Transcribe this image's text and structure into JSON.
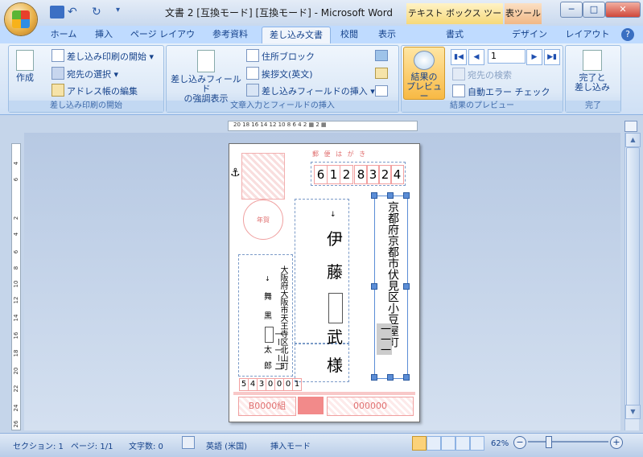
{
  "window": {
    "title": "文書 2 [互換モード] [互換モード] - Microsoft Word",
    "context_tab_textbox": "テキスト ボックス ツール",
    "context_tab_table": "表ツール",
    "min": "─",
    "max": "□",
    "close": "✕"
  },
  "tabs": [
    "ホーム",
    "挿入",
    "ページ レイアウト",
    "参考資料",
    "差し込み文書",
    "校閲",
    "表示",
    "書式",
    "デザイン",
    "レイアウト"
  ],
  "help": "?",
  "ribbon": {
    "create": "作成",
    "start_merge": "差し込み印刷の開始",
    "select_recipients": "宛先の選択",
    "edit_list": "アドレス帳の編集",
    "group1": "差し込み印刷の開始",
    "highlight_line1": "差し込みフィールド",
    "highlight_line2": "の強調表示",
    "address_block": "住所ブロック",
    "greeting": "挨拶文(英文)",
    "insert_field": "差し込みフィールドの挿入",
    "group2": "文章入力とフィールドの挿入",
    "preview_line1": "結果の",
    "preview_line2": "プレビュー",
    "record": "1",
    "find_recipient": "宛先の検索",
    "auto_check": "自動エラー チェック",
    "group3": "結果のプレビュー",
    "finish_line1": "完了と",
    "finish_line2": "差し込み",
    "group4": "完了"
  },
  "ruler": "20  18  16  14  12  10   8    6    4    2   ▦     2  ▦",
  "postcard": {
    "header": "郵 便 は が き",
    "zip": [
      "6",
      "1",
      "2",
      "8",
      "3",
      "2",
      "4"
    ],
    "address": "京都府京都市伏見区小豆屋町",
    "address_num": "一一一",
    "name_family_1": "伊",
    "name_family_2": "藤",
    "name_given": "武",
    "honorific": "様",
    "sender_address": "大阪府大阪市天王寺区北山町",
    "sender_num": "一ー一ー二",
    "sender_name_1": "舞",
    "sender_name_2": "黒",
    "sender_name_3": "太",
    "sender_name_4": "郎",
    "sender_zip": [
      "5",
      "4",
      "3",
      "0",
      "0",
      "0",
      "1"
    ],
    "lottery_left": "B0000組",
    "lottery_right": "000000",
    "stamp_caption": "年賀"
  },
  "status": {
    "section": "セクション: 1",
    "page": "ページ: 1/1",
    "words": "文字数: 0",
    "language": "英語 (米国)",
    "mode": "挿入モード",
    "zoom": "62%"
  }
}
